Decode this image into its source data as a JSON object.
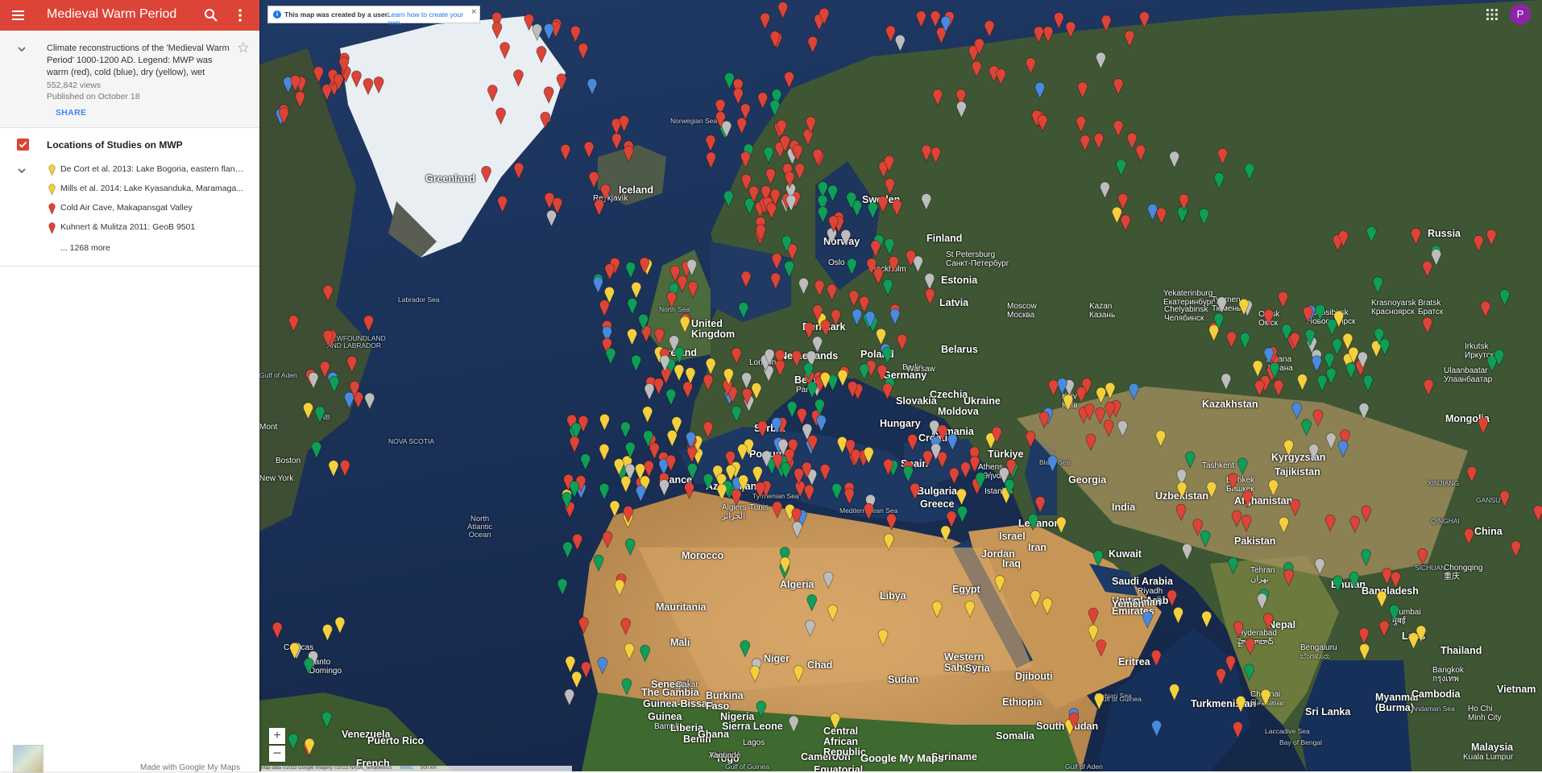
{
  "app": {
    "title": "Medieval Warm Period"
  },
  "info": {
    "description": "Climate reconstructions of the 'Medieval Warm Period' 1000-1200 AD. Legend: MWP was warm (red), cold (blue), dry (yellow), wet (green), no",
    "views": "552,842 views",
    "published": "Published on October 18",
    "share_label": "SHARE"
  },
  "layer": {
    "title": "Locations of Studies on MWP",
    "items": [
      {
        "label": "De Cort et al. 2013: Lake Bogoria, eastern flank...",
        "color": "#f4d03f"
      },
      {
        "label": "Mills et al. 2014: Lake Kyasanduka, Maramaga...",
        "color": "#f4d03f"
      },
      {
        "label": "Cold Air Cave, Makapansgat Valley",
        "color": "#db4437"
      },
      {
        "label": "Kuhnert & Mulitza 2011: GeoB 9501",
        "color": "#db4437"
      }
    ],
    "more_label": "... 1268 more"
  },
  "notice": {
    "text": "This map was created by a user.",
    "link": "Learn how to create your own."
  },
  "account": {
    "initial": "P"
  },
  "footer": {
    "made_with": "Made with Google My Maps",
    "logo": "Google My Maps",
    "map_data": "Map data ©2023 Google Imagery ©2023 NASA, TerraMetrics",
    "terms": "Terms",
    "scale": "500 km"
  },
  "colors": {
    "warm": "#db4437",
    "cold": "#4a89dc",
    "dry": "#f4d03f",
    "wet": "#0f9d58",
    "none": "#bdbdbd",
    "accent": "#db4437"
  },
  "icons": [
    "menu-icon",
    "search-icon",
    "more-vert-icon",
    "chevron-down-icon",
    "star-icon",
    "info-icon",
    "close-icon",
    "apps-grid-icon",
    "map-pin-icon"
  ],
  "place_labels": [
    {
      "text": "Greenland",
      "cls": "big"
    },
    {
      "text": "Iceland",
      "cls": "big"
    },
    {
      "text": "Reykjavík",
      "cls": ""
    },
    {
      "text": "Sweden",
      "cls": "big"
    },
    {
      "text": "Finland",
      "cls": "big"
    },
    {
      "text": "Norway",
      "cls": "big"
    },
    {
      "text": "Oslo",
      "cls": ""
    },
    {
      "text": "Stockholm",
      "cls": ""
    },
    {
      "text": "St Petersburg\nСанкт-Петербург",
      "cls": ""
    },
    {
      "text": "Estonia",
      "cls": "big"
    },
    {
      "text": "Latvia",
      "cls": "big"
    },
    {
      "text": "Moscow\nМосква",
      "cls": ""
    },
    {
      "text": "Belarus",
      "cls": "big"
    },
    {
      "text": "Russia",
      "cls": "big"
    },
    {
      "text": "Kazan\nКазань",
      "cls": ""
    },
    {
      "text": "Yekaterinburg\nЕкатеринбург",
      "cls": ""
    },
    {
      "text": "Chelyabinsk\nЧелябинск",
      "cls": ""
    },
    {
      "text": "Tyumen\nТюмень",
      "cls": ""
    },
    {
      "text": "Omsk\nОмск",
      "cls": ""
    },
    {
      "text": "Novosibirsk\nНовосибирск",
      "cls": ""
    },
    {
      "text": "Krasnoyarsk\nКрасноярск",
      "cls": ""
    },
    {
      "text": "Bratsk\nБратск",
      "cls": ""
    },
    {
      "text": "Irkutsk\nИркутск",
      "cls": ""
    },
    {
      "text": "Astana\nАстана",
      "cls": ""
    },
    {
      "text": "Kazakhstan",
      "cls": "big"
    },
    {
      "text": "Mongolia",
      "cls": "big"
    },
    {
      "text": "Ulaanbaatar\nУлаанбаатар",
      "cls": ""
    },
    {
      "text": "Norwegian Sea",
      "cls": "sea"
    },
    {
      "text": "North Sea",
      "cls": "sea"
    },
    {
      "text": "Labrador Sea",
      "cls": "sea"
    },
    {
      "text": "NEWFOUNDLAND\nAND LABRADOR",
      "cls": "sea"
    },
    {
      "text": "NOVA SCOTIA",
      "cls": "sea"
    },
    {
      "text": "NB",
      "cls": "sea"
    },
    {
      "text": "Boston",
      "cls": ""
    },
    {
      "text": "New York",
      "cls": ""
    },
    {
      "text": "Mont",
      "cls": ""
    },
    {
      "text": "North\nAtlantic\nOcean",
      "cls": "ocean"
    },
    {
      "text": "Ireland",
      "cls": "big"
    },
    {
      "text": "United\nKingdom",
      "cls": "big"
    },
    {
      "text": "London",
      "cls": ""
    },
    {
      "text": "Netherlands",
      "cls": "big"
    },
    {
      "text": "Belgium",
      "cls": "big"
    },
    {
      "text": "Paris",
      "cls": ""
    },
    {
      "text": "Germany",
      "cls": "big"
    },
    {
      "text": "Denmark",
      "cls": "big"
    },
    {
      "text": "Poland",
      "cls": "big"
    },
    {
      "text": "Berlin",
      "cls": ""
    },
    {
      "text": "Warsaw",
      "cls": ""
    },
    {
      "text": "Czechia",
      "cls": "big"
    },
    {
      "text": "Slovakia",
      "cls": "big"
    },
    {
      "text": "Hungary",
      "cls": "big"
    },
    {
      "text": "Ukraine",
      "cls": "big"
    },
    {
      "text": "Kyiv\nКиїв",
      "cls": ""
    },
    {
      "text": "Moldova",
      "cls": "big"
    },
    {
      "text": "Romania",
      "cls": "big"
    },
    {
      "text": "Croatia",
      "cls": "big"
    },
    {
      "text": "Serbia",
      "cls": "big"
    },
    {
      "text": "France",
      "cls": "big"
    },
    {
      "text": "Portugal",
      "cls": "big"
    },
    {
      "text": "Spain",
      "cls": "big"
    },
    {
      "text": "Bulgaria",
      "cls": "big"
    },
    {
      "text": "Greece",
      "cls": "big"
    },
    {
      "text": "Athens\nΑθήνα",
      "cls": ""
    },
    {
      "text": "Istanbul",
      "cls": ""
    },
    {
      "text": "Türkiye",
      "cls": "big"
    },
    {
      "text": "Black Sea",
      "cls": "sea"
    },
    {
      "text": "Georgia",
      "cls": "big"
    },
    {
      "text": "Azerbaijan",
      "cls": "big"
    },
    {
      "text": "Tyrrhenian Sea",
      "cls": "sea"
    },
    {
      "text": "Mediterranean Sea",
      "cls": "sea"
    },
    {
      "text": "Algiers\nالجزائر",
      "cls": ""
    },
    {
      "text": "Tunis",
      "cls": ""
    },
    {
      "text": "Morocco",
      "cls": "big"
    },
    {
      "text": "Algeria",
      "cls": "big"
    },
    {
      "text": "Libya",
      "cls": "big"
    },
    {
      "text": "Egypt",
      "cls": "big"
    },
    {
      "text": "Western\nSahara",
      "cls": "big"
    },
    {
      "text": "Mauritania",
      "cls": "big"
    },
    {
      "text": "Mali",
      "cls": "big"
    },
    {
      "text": "Niger",
      "cls": "big"
    },
    {
      "text": "Chad",
      "cls": "big"
    },
    {
      "text": "Sudan",
      "cls": "big"
    },
    {
      "text": "Syria",
      "cls": "big"
    },
    {
      "text": "Lebanon",
      "cls": "big"
    },
    {
      "text": "Israel",
      "cls": "big"
    },
    {
      "text": "Jordan",
      "cls": "big"
    },
    {
      "text": "Iraq",
      "cls": "big"
    },
    {
      "text": "Iran",
      "cls": "big"
    },
    {
      "text": "Kuwait",
      "cls": "big"
    },
    {
      "text": "Saudi Arabia",
      "cls": "big"
    },
    {
      "text": "Riyadh\nالرياض",
      "cls": ""
    },
    {
      "text": "United Arab\nEmirates",
      "cls": "big"
    },
    {
      "text": "Oman",
      "cls": "big"
    },
    {
      "text": "Yemen",
      "cls": "big"
    },
    {
      "text": "Eritrea",
      "cls": "big"
    },
    {
      "text": "Djibouti",
      "cls": "big"
    },
    {
      "text": "Ethiopia",
      "cls": "big"
    },
    {
      "text": "South Sudan",
      "cls": "big"
    },
    {
      "text": "Somalia",
      "cls": "big"
    },
    {
      "text": "Gulf of Aden",
      "cls": "sea"
    },
    {
      "text": "Arabian Sea",
      "cls": "sea"
    },
    {
      "text": "Turkmenistan",
      "cls": "big"
    },
    {
      "text": "Uzbekistan",
      "cls": "big"
    },
    {
      "text": "Tashkent",
      "cls": ""
    },
    {
      "text": "Bishkek\nБишкек",
      "cls": ""
    },
    {
      "text": "Kyrgyzstan",
      "cls": "big"
    },
    {
      "text": "Tajikistan",
      "cls": "big"
    },
    {
      "text": "Afghanistan",
      "cls": "big"
    },
    {
      "text": "Pakistan",
      "cls": "big"
    },
    {
      "text": "Tehran\nتهران",
      "cls": ""
    },
    {
      "text": "India",
      "cls": "big"
    },
    {
      "text": "Nepal",
      "cls": "big"
    },
    {
      "text": "Bhutan",
      "cls": "big"
    },
    {
      "text": "Bangladesh",
      "cls": "big"
    },
    {
      "text": "Mumbai\nमुंबई",
      "cls": ""
    },
    {
      "text": "Hyderabad\nహైదరాబాద్",
      "cls": ""
    },
    {
      "text": "Bengaluru\nಬೆಂಗಳೂರು",
      "cls": ""
    },
    {
      "text": "Chennai\nசென்னை",
      "cls": ""
    },
    {
      "text": "Sri Lanka",
      "cls": "big"
    },
    {
      "text": "Laccadive Sea",
      "cls": "sea"
    },
    {
      "text": "Bay of Bengal",
      "cls": "sea"
    },
    {
      "text": "Myanmar\n(Burma)",
      "cls": "big"
    },
    {
      "text": "Laos",
      "cls": "big"
    },
    {
      "text": "Thailand",
      "cls": "big"
    },
    {
      "text": "Bangkok\nกรุงเทพ",
      "cls": ""
    },
    {
      "text": "Cambodia",
      "cls": "big"
    },
    {
      "text": "Vietnam",
      "cls": "big"
    },
    {
      "text": "Ho Chi\nMinh City",
      "cls": ""
    },
    {
      "text": "Andaman Sea",
      "cls": "sea"
    },
    {
      "text": "Malaysia",
      "cls": "big"
    },
    {
      "text": "Kuala Lumpur",
      "cls": ""
    },
    {
      "text": "China",
      "cls": "big"
    },
    {
      "text": "XINJIANG",
      "cls": "sea"
    },
    {
      "text": "QINGHAI",
      "cls": "sea"
    },
    {
      "text": "GANSU",
      "cls": "sea"
    },
    {
      "text": "SICHUAN",
      "cls": "sea"
    },
    {
      "text": "Chongqing\n重庆",
      "cls": ""
    },
    {
      "text": "Senegal",
      "cls": "big"
    },
    {
      "text": "Dakar",
      "cls": ""
    },
    {
      "text": "The Gambia",
      "cls": "big"
    },
    {
      "text": "Guinea-Bissau",
      "cls": "big"
    },
    {
      "text": "Guinea",
      "cls": "big"
    },
    {
      "text": "Bamako",
      "cls": ""
    },
    {
      "text": "Burkina\nFaso",
      "cls": "big"
    },
    {
      "text": "Sierra Leone",
      "cls": "big"
    },
    {
      "text": "Liberia",
      "cls": "big"
    },
    {
      "text": "Benin",
      "cls": "big"
    },
    {
      "text": "Togo",
      "cls": "big"
    },
    {
      "text": "Ghana",
      "cls": "big"
    },
    {
      "text": "Nigeria",
      "cls": "big"
    },
    {
      "text": "Lagos",
      "cls": ""
    },
    {
      "text": "Abidjan",
      "cls": ""
    },
    {
      "text": "Gulf of Guinea",
      "cls": "sea"
    },
    {
      "text": "Cameroon",
      "cls": "big"
    },
    {
      "text": "Central\nAfrican\nRepublic",
      "cls": "big"
    },
    {
      "text": "Equatorial",
      "cls": "big"
    },
    {
      "text": "Venezuela",
      "cls": "big"
    },
    {
      "text": "Caracas",
      "cls": ""
    },
    {
      "text": "Santo\nDomingo",
      "cls": ""
    },
    {
      "text": "Puerto Rico",
      "cls": "big"
    },
    {
      "text": "French\nGuiana",
      "cls": "big"
    },
    {
      "text": "Suriname",
      "cls": "big"
    },
    {
      "text": "Yaoundé",
      "cls": ""
    },
    {
      "text": "Gulf of Guinea",
      "cls": "sea"
    },
    {
      "text": "Gulf of Aden",
      "cls": "sea"
    },
    {
      "text": "REC",
      "cls": ""
    }
  ]
}
